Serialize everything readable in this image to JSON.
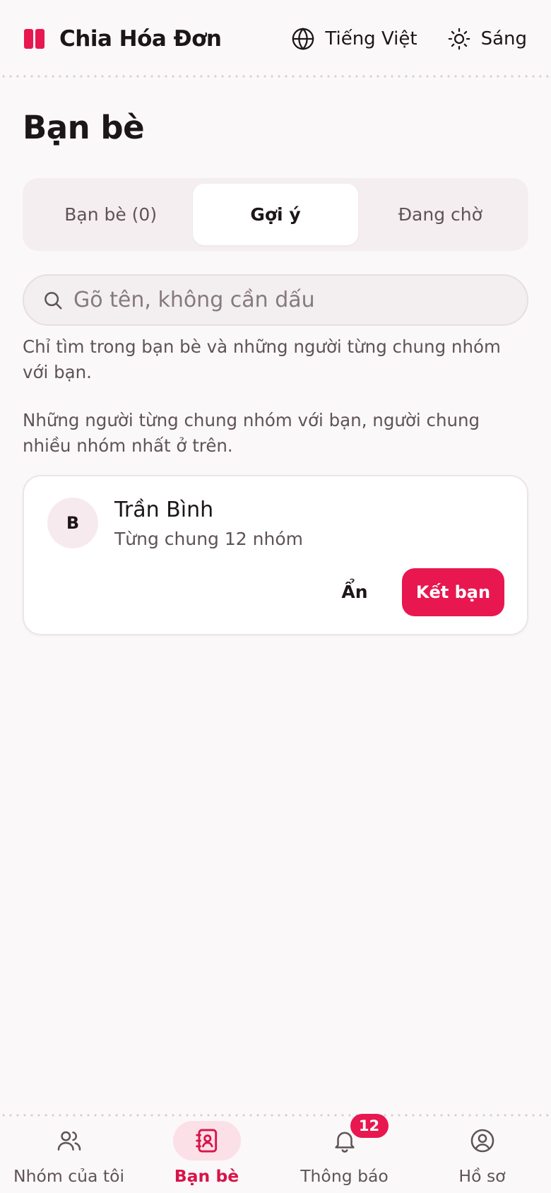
{
  "app": {
    "name": "Chia Hóa Đơn",
    "language_label": "Tiếng Việt",
    "theme_label": "Sáng"
  },
  "page": {
    "title": "Bạn bè"
  },
  "tabs": [
    {
      "label": "Bạn bè (0)",
      "active": false
    },
    {
      "label": "Gợi ý",
      "active": true
    },
    {
      "label": "Đang chờ",
      "active": false
    }
  ],
  "search": {
    "placeholder": "Gõ tên, không cần dấu",
    "value": "",
    "hint": "Chỉ tìm trong bạn bè và những người từng chung nhóm với bạn."
  },
  "suggestions": {
    "description": "Những người từng chung nhóm với bạn, người chung nhiều nhóm nhất ở trên.",
    "items": [
      {
        "initial": "B",
        "name": "Trần Bình",
        "subtitle": "Từng chung 12 nhóm",
        "hide_label": "Ẩn",
        "add_label": "Kết bạn"
      }
    ]
  },
  "bottom_nav": [
    {
      "label": "Nhóm của tôi",
      "icon": "users-icon",
      "active": false
    },
    {
      "label": "Bạn bè",
      "icon": "contact-book-icon",
      "active": true
    },
    {
      "label": "Thông báo",
      "icon": "bell-icon",
      "active": false,
      "badge": "12"
    },
    {
      "label": "Hồ sơ",
      "icon": "user-circle-icon",
      "active": false
    }
  ],
  "colors": {
    "accent": "#e8174f",
    "background": "#fbf8f9",
    "text": "#1c1618",
    "muted_text": "#5e5358"
  }
}
